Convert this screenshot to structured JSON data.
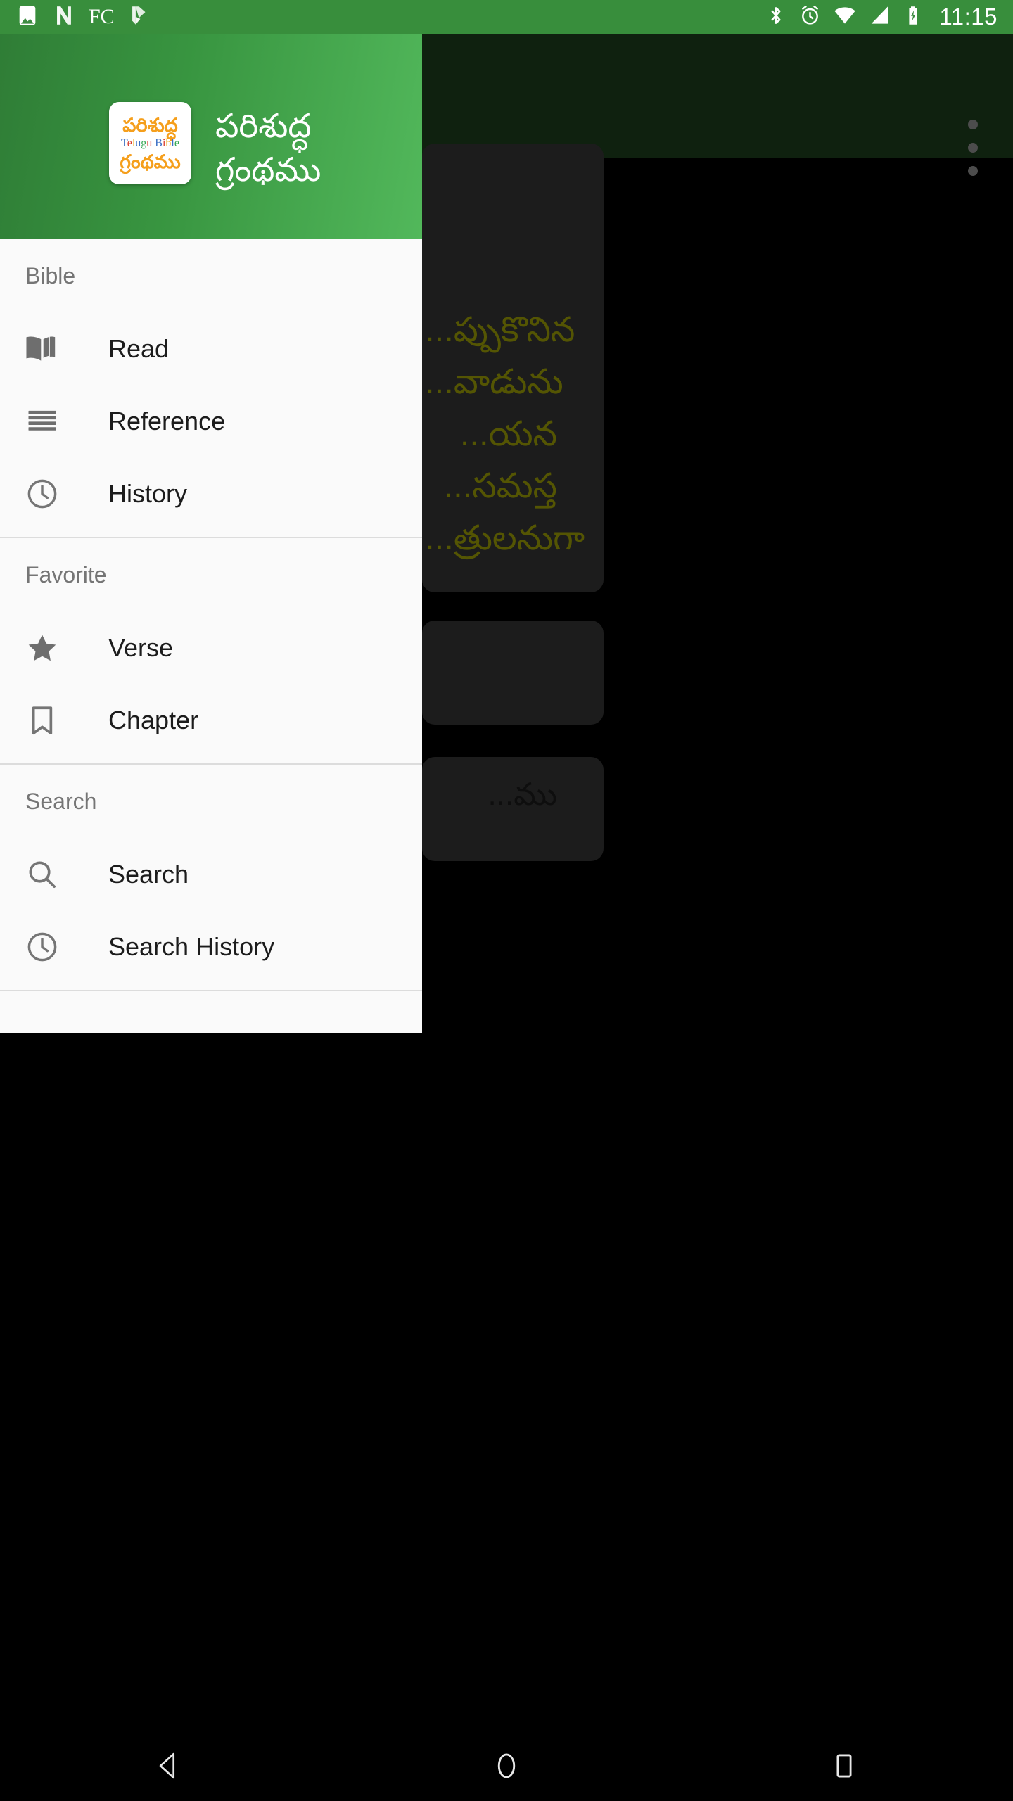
{
  "status_bar": {
    "time": "11:15",
    "fc_label": "FC",
    "icons_left": [
      "photo-icon",
      "nova-n-icon",
      "fc-icon",
      "check-mark-icon"
    ],
    "icons_right": [
      "bluetooth-icon",
      "alarm-icon",
      "wifi-icon",
      "signal-icon",
      "battery-charging-icon"
    ],
    "background": "#388e3c"
  },
  "drawer": {
    "title": "పరిశుద్ధ\nగ్రంథము",
    "title_line1": "పరిశుద్ధ",
    "title_line2": "గ్రంథము",
    "logo": {
      "line1": "పరిశుద్ధ",
      "line2_letters": [
        "T",
        "e",
        "l",
        "u",
        "g",
        "u",
        " ",
        "B",
        "i",
        "b",
        "l",
        "e"
      ],
      "line2": "Telugu Bible",
      "line3": "గ్రంథము"
    },
    "header_gradient_from": "#2f7d36",
    "header_gradient_to": "#52b85b",
    "sections": [
      {
        "label": "Bible",
        "items": [
          {
            "label": "Read",
            "icon": "open-book-icon"
          },
          {
            "label": "Reference",
            "icon": "list-lines-icon"
          },
          {
            "label": "History",
            "icon": "clock-icon"
          }
        ]
      },
      {
        "label": "Favorite",
        "items": [
          {
            "label": "Verse",
            "icon": "star-icon"
          },
          {
            "label": "Chapter",
            "icon": "bookmark-icon"
          }
        ]
      },
      {
        "label": "Search",
        "items": [
          {
            "label": "Search",
            "icon": "magnifier-icon"
          },
          {
            "label": "Search History",
            "icon": "clock-icon"
          }
        ]
      }
    ]
  },
  "background_app": {
    "toolbar_color": "#1d3d1c",
    "overflow_menu": "more-vert-icon",
    "verse_card_color": "#333333",
    "verse_text_color": "#9a9c07",
    "verse_text_1": "...ప్పుకొనిన\n...వాడును\n...యన\n...సమస్త\n...త్రులనుగా",
    "verse_text_3": "...ము"
  },
  "system_nav": {
    "buttons": [
      {
        "name": "back",
        "icon": "back-triangle-icon"
      },
      {
        "name": "home",
        "icon": "home-circle-icon"
      },
      {
        "name": "recents",
        "icon": "recents-square-icon"
      }
    ]
  }
}
